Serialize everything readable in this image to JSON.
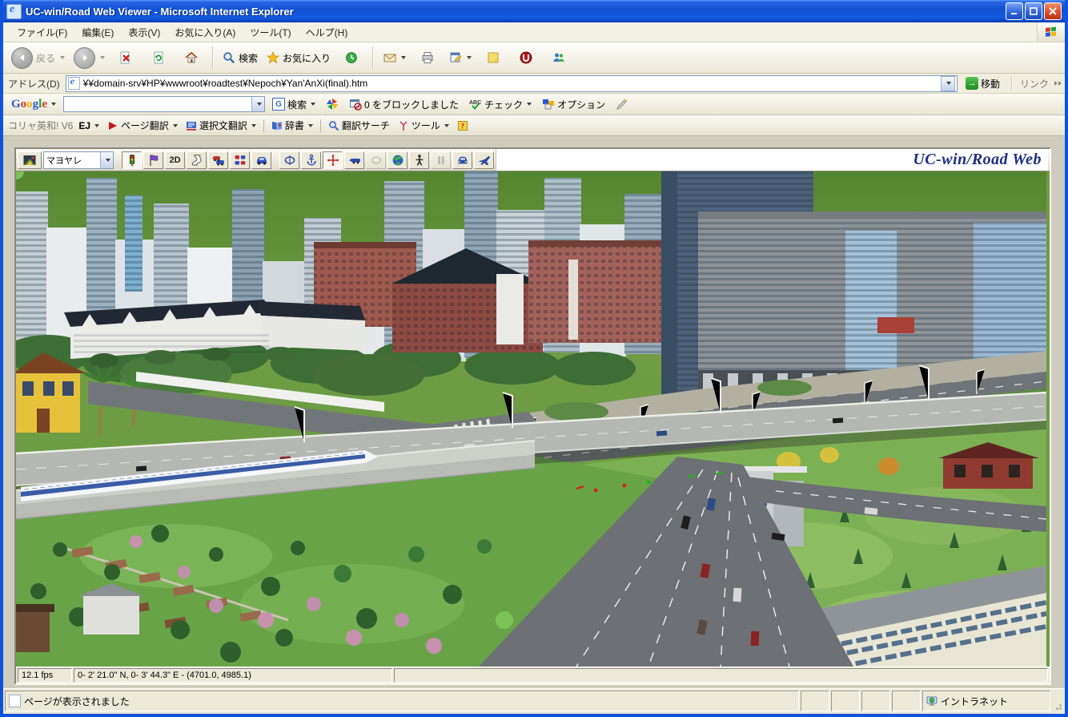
{
  "window": {
    "title": "UC-win/Road Web Viewer - Microsoft Internet Explorer"
  },
  "menu": {
    "items": [
      {
        "label": "ファイル(F)"
      },
      {
        "label": "編集(E)"
      },
      {
        "label": "表示(V)"
      },
      {
        "label": "お気に入り(A)"
      },
      {
        "label": "ツール(T)"
      },
      {
        "label": "ヘルプ(H)"
      }
    ]
  },
  "toolbar": {
    "back_label": "戻る",
    "search_label": "検索",
    "favorites_label": "お気に入り"
  },
  "address": {
    "label": "アドレス(D)",
    "url": "¥¥domain-srv¥HP¥wwwroot¥roadtest¥Nepoch¥Yan'AnXi(final).htm",
    "go_label": "移動",
    "links_label": "リンク"
  },
  "google": {
    "logo": "Google",
    "search_value": "",
    "search_button": "検索",
    "blocked_text": "0 をブロックしました",
    "check_label": "チェック",
    "options_label": "オプション"
  },
  "trans": {
    "product": "コリャ英和! V6",
    "pair": "EJ",
    "page": "ページ翻訳",
    "selection": "選択文翻訳",
    "dict": "辞書",
    "search": "翻訳サーチ",
    "tools": "ツール"
  },
  "viewer": {
    "scenario_value": "マヨヤレ",
    "twod_label": "2D",
    "logo": "UC-win/Road Web",
    "toolbar_icon_names": [
      "scene-image",
      "scenario-select",
      "traffic-signal",
      "flag",
      "2d",
      "route-ribbon",
      "vehicles",
      "traffic-grid",
      "car",
      "orbit-rotate",
      "anchor",
      "pan-move",
      "drive-forward",
      "rotate-disabled",
      "globe",
      "walk-person",
      "pause",
      "drive-car",
      "fly-plane"
    ],
    "status": {
      "fps": "12.1 fps",
      "coords": "0- 2' 21.0\" N, 0- 3' 44.3\" E  -  (4701.0, 4985.1)"
    }
  },
  "status": {
    "message": "ページが表示されました",
    "zone": "イントラネット"
  },
  "icons": {
    "back": "green-circle-arrow-left-disabled",
    "forward": "green-circle-arrow-right-disabled",
    "stop": "document-red-x",
    "refresh": "document-green-arrows",
    "home": "house",
    "search": "magnifier",
    "favorites": "gold-star",
    "history": "green-clock",
    "mail": "envelope",
    "print": "printer",
    "edit": "window-arrow",
    "note": "yellow-note",
    "norton": "red-u-circle",
    "messenger": "two-people",
    "zone": "intranet-monitor"
  },
  "colors": {
    "titlebar_blue": "#1150d2",
    "chrome_tan": "#ece9d8",
    "logo_navy": "#1f2e86",
    "go_green": "#1f8a22",
    "google_blue": "#2a5bd7",
    "google_red": "#d23c2a",
    "google_yellow": "#f0b400",
    "google_green": "#1aa53c"
  }
}
